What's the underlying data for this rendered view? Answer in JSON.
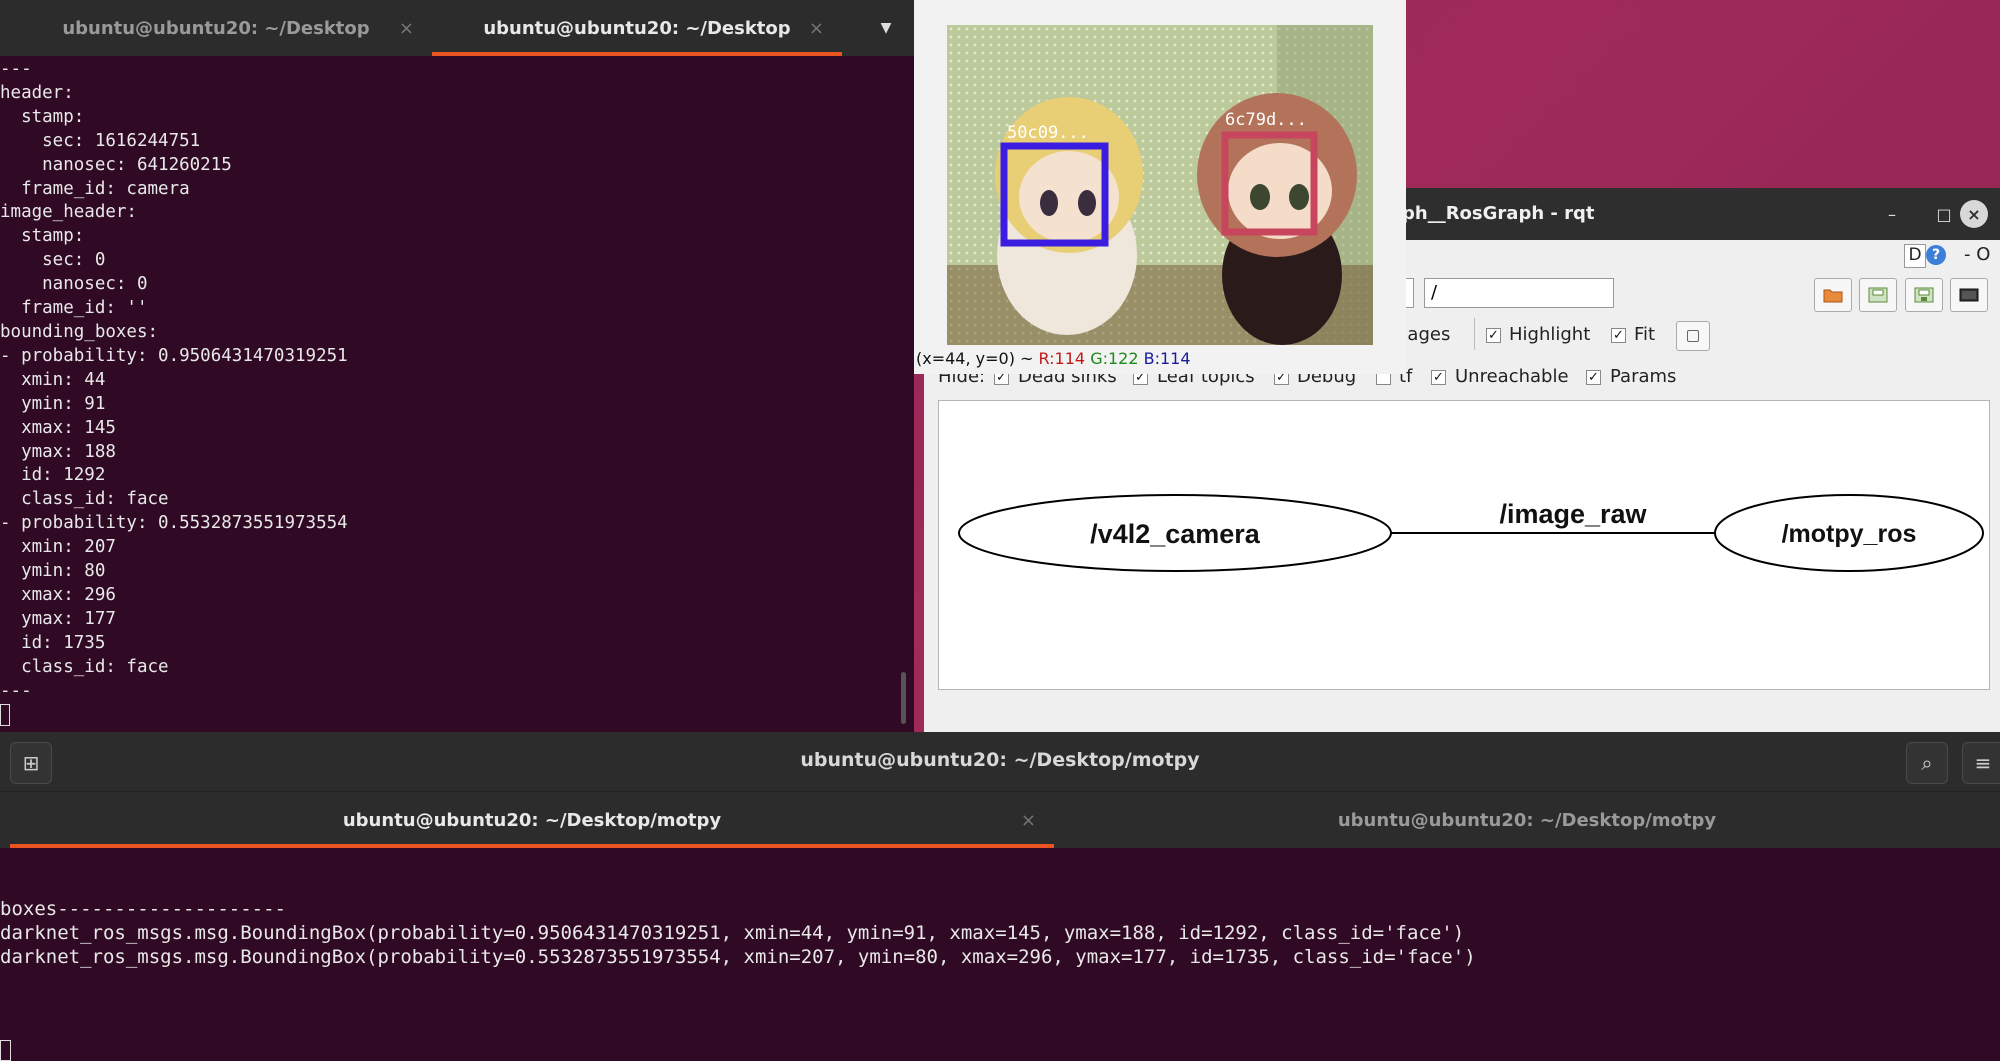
{
  "terminal_top": {
    "tabs": [
      {
        "label": "ubuntu@ubuntu20: ~/Desktop",
        "close": "×"
      },
      {
        "label": "ubuntu@ubuntu20: ~/Desktop",
        "close": "×"
      }
    ],
    "menu_icon": "▼",
    "output": "---\nheader:\n  stamp:\n    sec: 1616244751\n    nanosec: 641260215\n  frame_id: camera\nimage_header:\n  stamp:\n    sec: 0\n    nanosec: 0\n  frame_id: ''\nbounding_boxes:\n- probability: 0.9506431470319251\n  xmin: 44\n  ymin: 91\n  xmax: 145\n  ymax: 188\n  id: 1292\n  class_id: face\n- probability: 0.5532873551973554\n  xmin: 207\n  ymin: 80\n  xmax: 296\n  ymax: 177\n  id: 1735\n  class_id: face\n---"
  },
  "image_view": {
    "box_labels": [
      "50c09...",
      "6c79d..."
    ],
    "coords_prefix": "(x=44, y=0) ~ ",
    "r": "R:114",
    "g": "G:122",
    "b": "B:114",
    "colors": {
      "box1": "#3a1de0",
      "box2": "#c8455e",
      "r": "#c01818",
      "g": "#1a8a1a",
      "b": "#1a1a9a"
    }
  },
  "rqt": {
    "title": "ph__RosGraph - rqt",
    "window_buttons": {
      "minimize": "–",
      "maximize": "□",
      "close": "×"
    },
    "help_d": "D",
    "help_q": "?",
    "help_o": "- O",
    "namespace_value": "/",
    "images_label": "nages",
    "highlight_label": "Highlight",
    "fit_label": "Fit",
    "hide_label": "Hide:",
    "hide_options": [
      {
        "label": "Dead sinks",
        "checked": true
      },
      {
        "label": "Leaf topics",
        "checked": true
      },
      {
        "label": "Debug",
        "checked": true
      },
      {
        "label": "tf",
        "checked": false
      },
      {
        "label": "Unreachable",
        "checked": true
      },
      {
        "label": "Params",
        "checked": true
      }
    ],
    "checkmark": "✓",
    "graph": {
      "source_node": "/v4l2_camera",
      "topic": "/image_raw",
      "target_node": "/motpy_ros"
    },
    "toolbar_icons": [
      "folder-open-icon",
      "save-dot-icon",
      "save-image-icon",
      "screenshot-icon"
    ]
  },
  "terminal_bottom": {
    "window_title": "ubuntu@ubuntu20: ~/Desktop/motpy",
    "new_tab_icon": "⊞",
    "search_icon": "⌕",
    "menu_icon": "≡",
    "tabs": [
      {
        "label": "ubuntu@ubuntu20: ~/Desktop/motpy",
        "close": "×"
      },
      {
        "label": "ubuntu@ubuntu20: ~/Desktop/motpy"
      }
    ],
    "output": "boxes--------------------\ndarknet_ros_msgs.msg.BoundingBox(probability=0.9506431470319251, xmin=44, ymin=91, xmax=145, ymax=188, id=1292, class_id='face')\ndarknet_ros_msgs.msg.BoundingBox(probability=0.5532873551973554, xmin=207, ymin=80, xmax=296, ymax=177, id=1735, class_id='face')"
  }
}
